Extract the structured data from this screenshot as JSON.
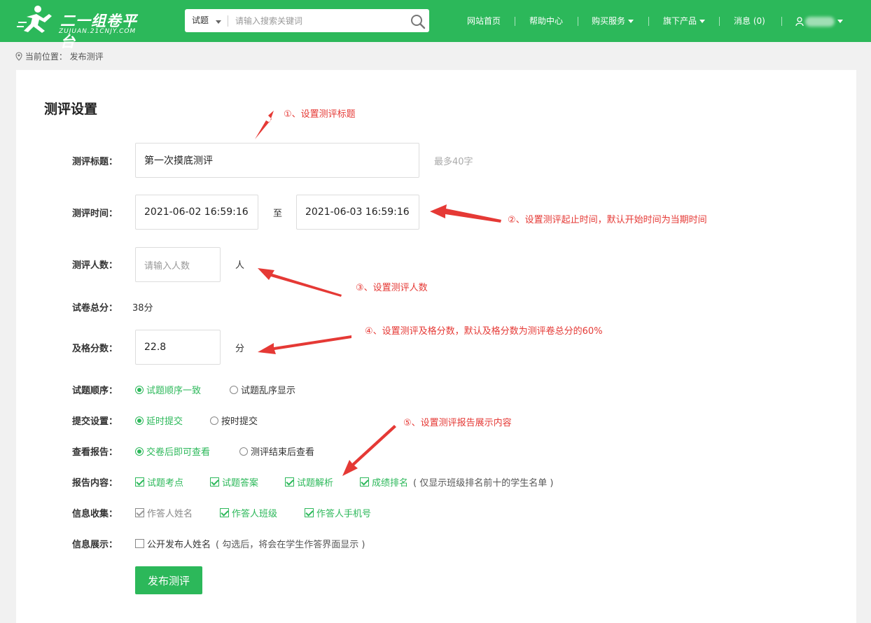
{
  "header": {
    "logo_text": "二一组卷平台",
    "logo_sub": "ZUJUAN.21CNJY.COM",
    "search_type": "试题",
    "search_placeholder": "请输入搜索关键词",
    "nav": [
      "网站首页",
      "帮助中心",
      "购买服务",
      "旗下产品",
      "消息 (0)"
    ]
  },
  "breadcrumb": "当前位置： 发布测评",
  "page_title": "测评设置",
  "form": {
    "title_label": "测评标题：",
    "title_value": "第一次摸底测评",
    "title_hint": "最多40字",
    "time_label": "测评时间：",
    "time_start": "2021-06-02 16:59:16",
    "time_to": "至",
    "time_end": "2021-06-03 16:59:16",
    "count_label": "测评人数：",
    "count_placeholder": "请输入人数",
    "count_unit": "人",
    "total_label": "试卷总分：",
    "total_value": "38分",
    "pass_label": "及格分数：",
    "pass_value": "22.8",
    "pass_unit": "分",
    "order_label": "试题顺序：",
    "order_opts": [
      "试题顺序一致",
      "试题乱序显示"
    ],
    "submit_label": "提交设置：",
    "submit_opts": [
      "延时提交",
      "按时提交"
    ],
    "report_label": "查看报告：",
    "report_opts": [
      "交卷后即可查看",
      "测评结束后查看"
    ],
    "content_label": "报告内容：",
    "content_opts": [
      "试题考点",
      "试题答案",
      "试题解析",
      "成绩排名"
    ],
    "content_note": "( 仅显示班级排名前十的学生名单 )",
    "collect_label": "信息收集：",
    "collect_opts": [
      "作答人姓名",
      "作答人班级",
      "作答人手机号"
    ],
    "display_label": "信息展示：",
    "display_opt": "公开发布人姓名",
    "display_note": "( 勾选后，将会在学生作答界面显示 )",
    "publish_button": "发布测评"
  },
  "annotations": [
    "①、设置测评标题",
    "②、设置测评起止时间，默认开始时间为当期时间",
    "③、设置测评人数",
    "④、设置测评及格分数，默认及格分数为测评卷总分的60%",
    "⑤、设置测评报告展示内容"
  ],
  "colors": {
    "brand": "#2cb85a",
    "annotation": "#e53935"
  }
}
